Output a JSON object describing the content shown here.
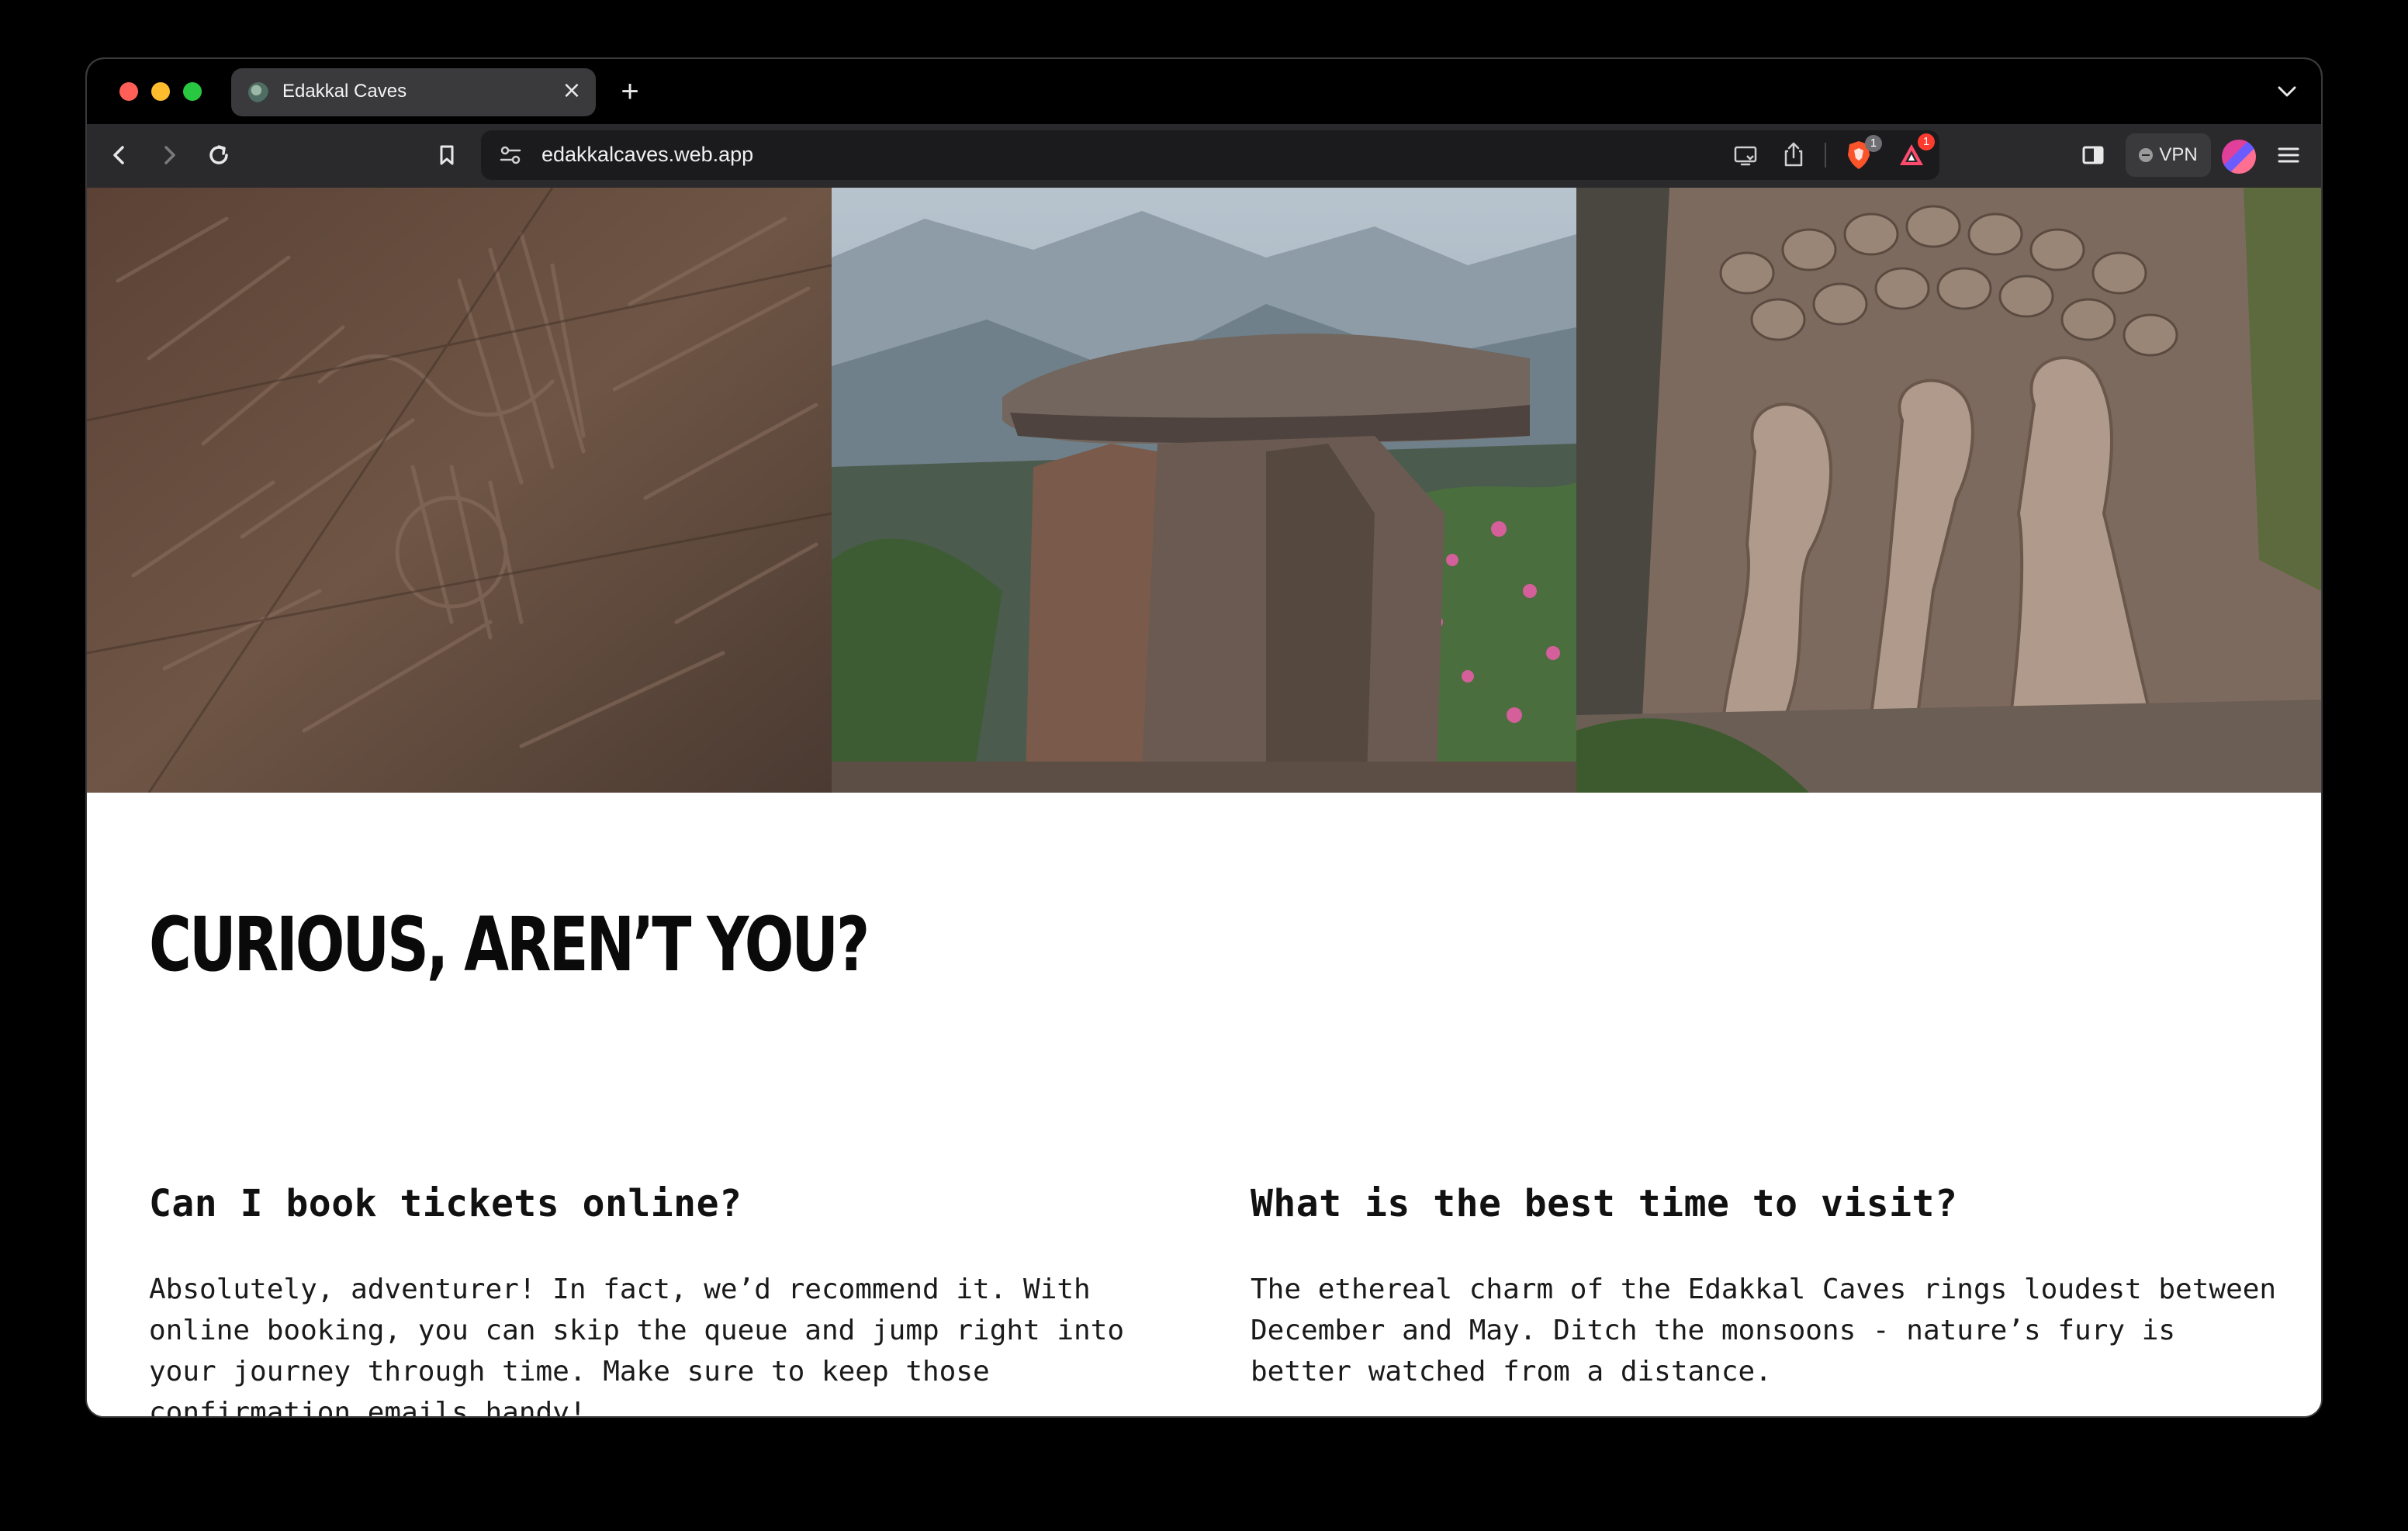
{
  "browser": {
    "tab": {
      "title": "Edakkal Caves",
      "favicon": "globe-favicon-icon"
    },
    "address": {
      "url": "edakkalcaves.web.app"
    },
    "badges": {
      "brave_shields": "1",
      "rewards": "1"
    },
    "vpn_label": "VPN",
    "colors": {
      "toolbar": "#2a2a2c",
      "tab_active": "#3a3a3c",
      "urlbar": "#1b1b1d",
      "badge_red": "#ff3b30",
      "badge_grey": "#6e6e73"
    }
  },
  "page": {
    "gallery": [
      {
        "name": "petroglyph-wall-photo"
      },
      {
        "name": "dolmen-rock-photo"
      },
      {
        "name": "relief-carving-photo"
      }
    ],
    "heading": "CURIOUS, AREN’T YOU?",
    "faq": [
      {
        "question": "Can I book tickets online?",
        "answer": "Absolutely, adventurer! In fact, we’d recommend it. With online booking, you can skip the queue and jump right into your journey through time. Make sure to keep those confirmation emails handy!"
      },
      {
        "question": "What is the best time to visit?",
        "answer": "The ethereal charm of the Edakkal Caves rings loudest between December and May. Ditch the monsoons - nature’s fury is better watched from a distance."
      }
    ]
  }
}
